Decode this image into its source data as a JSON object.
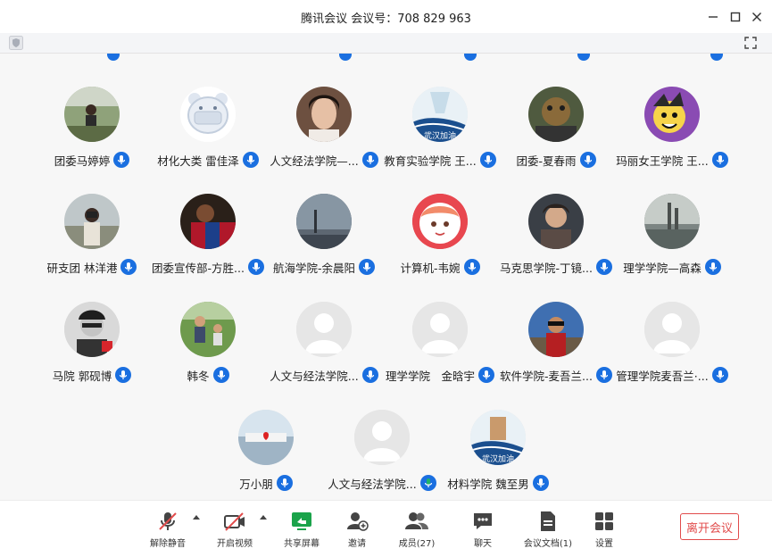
{
  "window": {
    "title": "腾讯会议 会议号：708 829 963",
    "controls": [
      "minimize-icon",
      "maximize-icon",
      "close-icon"
    ]
  },
  "colors": {
    "mic_blue": "#1a6fe0",
    "mic_green": "#1fb36b",
    "leave_red": "#e14b4b",
    "toolbar_green": "#1aa34a"
  },
  "participants": [
    {
      "name": "团委马婷婷",
      "mic": "blue"
    },
    {
      "name": "材化大类 雷佳泽",
      "mic": "blue"
    },
    {
      "name": "人文经法学院—...",
      "mic": "blue"
    },
    {
      "name": "教育实验学院 王...",
      "mic": "blue"
    },
    {
      "name": "团委-夏春雨",
      "mic": "blue"
    },
    {
      "name": "玛丽女王学院 王...",
      "mic": "blue"
    },
    {
      "name": "研支团 林洋港",
      "mic": "blue"
    },
    {
      "name": "团委宣传部-方胜...",
      "mic": "blue"
    },
    {
      "name": "航海学院-余晨阳",
      "mic": "blue"
    },
    {
      "name": "计算机-韦婉",
      "mic": "blue"
    },
    {
      "name": "马克思学院-丁镜...",
      "mic": "blue"
    },
    {
      "name": "理学学院—高森",
      "mic": "blue"
    },
    {
      "name": "马院 郭砚博",
      "mic": "blue"
    },
    {
      "name": "韩冬",
      "mic": "blue"
    },
    {
      "name": "人文与经法学院...",
      "mic": "blue"
    },
    {
      "name": "理学学院　金晗宇",
      "mic": "blue"
    },
    {
      "name": "软件学院-麦吾兰...",
      "mic": "blue"
    },
    {
      "name": "管理学院麦吾兰·...",
      "mic": "blue"
    },
    {
      "name": "万小朋",
      "mic": "blue"
    },
    {
      "name": "人文与经法学院...",
      "mic": "green"
    },
    {
      "name": "材料学院 魏至男",
      "mic": "blue"
    }
  ],
  "avatar_text": {
    "wuhan1": "武汉加油",
    "wuhan2": "武汉加油"
  },
  "toolbar": {
    "unmute": "解除静音",
    "start_video": "开启视频",
    "share_screen": "共享屏幕",
    "invite": "邀请",
    "members": "成员(27)",
    "chat": "聊天",
    "docs": "会议文档(1)",
    "settings": "设置",
    "leave": "离开会议"
  }
}
